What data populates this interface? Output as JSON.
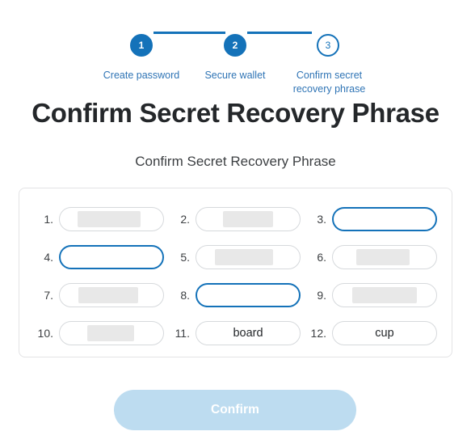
{
  "stepper": {
    "accent_color": "#1472b9",
    "steps": [
      {
        "number": "1",
        "label": "Create password",
        "state": "done"
      },
      {
        "number": "2",
        "label": "Secure wallet",
        "state": "done"
      },
      {
        "number": "3",
        "label": "Confirm secret\nrecovery phrase",
        "state": "current"
      }
    ]
  },
  "header": {
    "title": "Confirm Secret Recovery Phrase",
    "subtitle": "Confirm Secret Recovery Phrase"
  },
  "seed_phrase": {
    "words": [
      {
        "index": "1.",
        "value": "",
        "state": "redacted",
        "redaction_width": "w1"
      },
      {
        "index": "2.",
        "value": "",
        "state": "redacted",
        "redaction_width": "w2"
      },
      {
        "index": "3.",
        "value": "",
        "state": "focused-empty",
        "redaction_width": ""
      },
      {
        "index": "4.",
        "value": "",
        "state": "focused-empty",
        "redaction_width": ""
      },
      {
        "index": "5.",
        "value": "",
        "state": "redacted",
        "redaction_width": "w3"
      },
      {
        "index": "6.",
        "value": "",
        "state": "redacted",
        "redaction_width": "w4"
      },
      {
        "index": "7.",
        "value": "",
        "state": "redacted",
        "redaction_width": "w5"
      },
      {
        "index": "8.",
        "value": "",
        "state": "focused-empty",
        "redaction_width": ""
      },
      {
        "index": "9.",
        "value": "",
        "state": "redacted",
        "redaction_width": "w6"
      },
      {
        "index": "10.",
        "value": "",
        "state": "redacted",
        "redaction_width": "w7"
      },
      {
        "index": "11.",
        "value": "board",
        "state": "filled",
        "redaction_width": ""
      },
      {
        "index": "12.",
        "value": "cup",
        "state": "filled",
        "redaction_width": ""
      }
    ]
  },
  "actions": {
    "confirm_label": "Confirm",
    "confirm_disabled": true,
    "confirm_color": "#bddcf0"
  }
}
